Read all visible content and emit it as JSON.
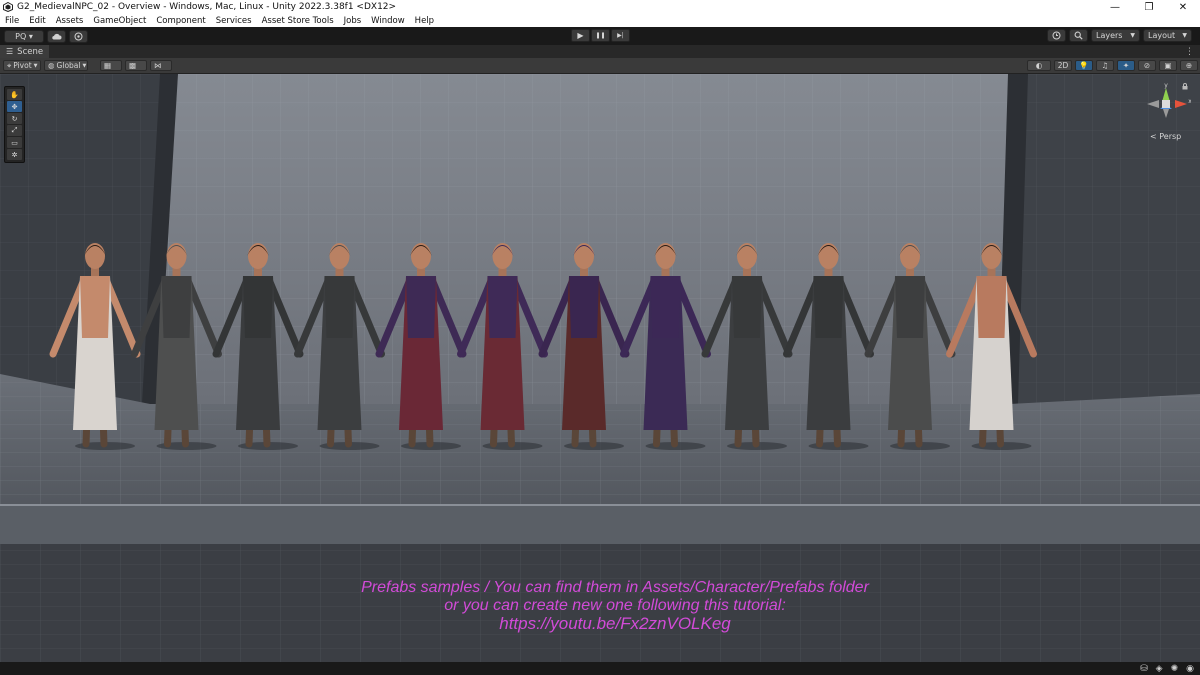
{
  "window": {
    "title": "G2_MedievalNPC_02 - Overview - Windows, Mac, Linux - Unity 2022.3.38f1 <DX12>",
    "minimize": "—",
    "maximize": "❐",
    "close": "✕"
  },
  "menu": [
    "File",
    "Edit",
    "Assets",
    "GameObject",
    "Component",
    "Services",
    "Asset Store Tools",
    "Jobs",
    "Window",
    "Help"
  ],
  "toolbar": {
    "account": "PQ ▾",
    "play": "▶",
    "pause": "❚❚",
    "step": "▶|",
    "layers": "Layers",
    "layout": "Layout"
  },
  "scene_tab": {
    "label": "Scene"
  },
  "scene_toolbar": {
    "pivot": "Pivot",
    "global": "Global",
    "mode_2d": "2D"
  },
  "tools": [
    "✋",
    "✥",
    "↻",
    "⤢",
    "▭",
    "✲"
  ],
  "gizmo": {
    "axis_y": "y",
    "axis_x": "x",
    "projection": "< Persp"
  },
  "caption": {
    "line1": "Prefabs samples / You can find them in Assets/Character/Prefabs folder",
    "line2": "or you can create new one following this tutorial:",
    "line3": "https://youtu.be/Fx2znVOLKeg"
  },
  "characters": [
    {
      "name": "woman-underwear",
      "body": "#c48a6c",
      "cloth": "#d9d4cf",
      "hair": "#2a1d17"
    },
    {
      "name": "hooded-beggar-woman",
      "body": "#3e3f40",
      "cloth": "#4e4f4f",
      "hair": "#505152"
    },
    {
      "name": "robed-woman",
      "body": "#333536",
      "cloth": "#3a3c3e",
      "hair": "#261a14"
    },
    {
      "name": "hooded-monk",
      "body": "#37393a",
      "cloth": "#3c3e40",
      "hair": "#4a4b4c"
    },
    {
      "name": "noble-woman",
      "body": "#3e2a55",
      "cloth": "#6a2836",
      "hair": "#2b1c14"
    },
    {
      "name": "noble-woman-hat",
      "body": "#3f2a57",
      "cloth": "#6a2a34",
      "hair": "#3d2a58"
    },
    {
      "name": "noble-man-hat",
      "body": "#3a2650",
      "cloth": "#5a2a2a",
      "hair": "#3b2757"
    },
    {
      "name": "noble-man",
      "body": "#3c2856",
      "cloth": "#3b2a55",
      "hair": "#2a1c14"
    },
    {
      "name": "hooded-monk-2",
      "body": "#37393a",
      "cloth": "#3c3e40",
      "hair": "#4a4b4c"
    },
    {
      "name": "robed-man",
      "body": "#343637",
      "cloth": "#3b3d3f",
      "hair": "#261a14"
    },
    {
      "name": "ragged-man",
      "body": "#3d3e3f",
      "cloth": "#4b4c4c",
      "hair": "#4b4c4d"
    },
    {
      "name": "man-underwear",
      "body": "#b87a5f",
      "cloth": "#d6d2ce",
      "hair": "#2a1d17"
    }
  ]
}
